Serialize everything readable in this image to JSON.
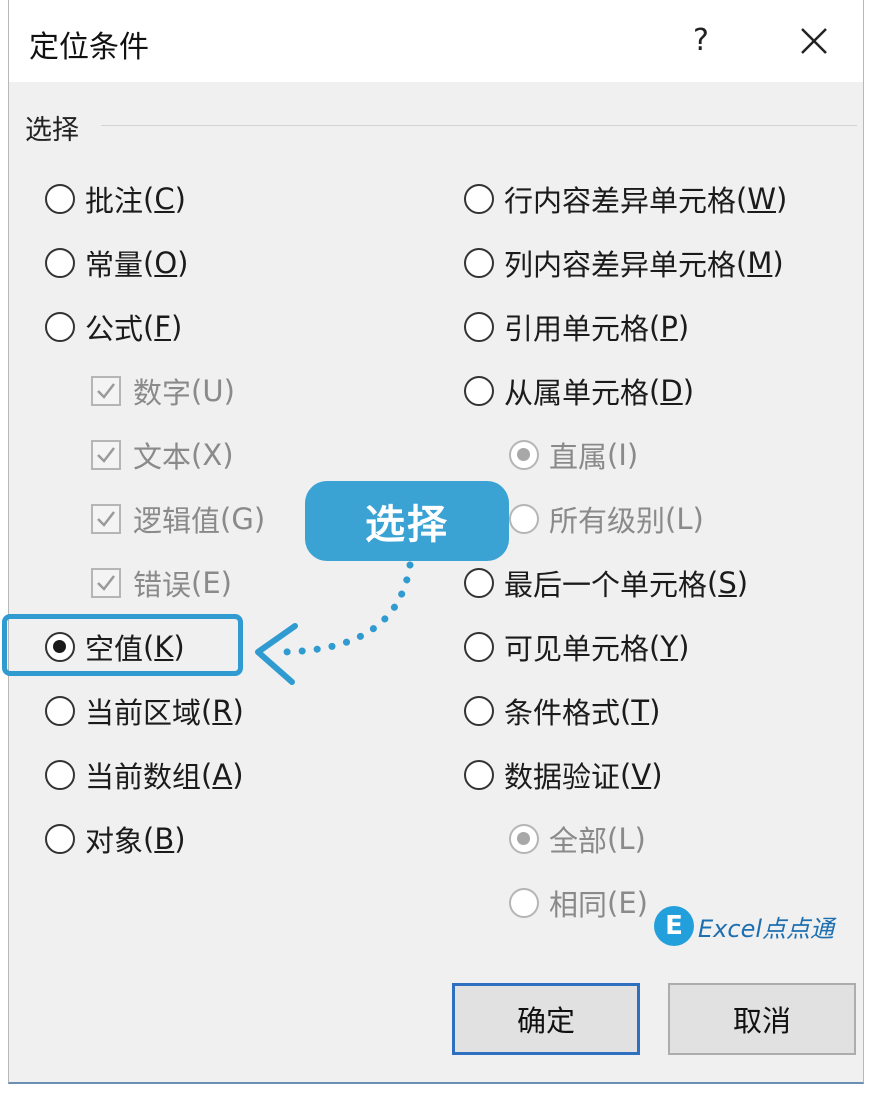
{
  "dialog": {
    "title": "定位条件",
    "help_label": "?",
    "group_title": "选择"
  },
  "left_options": [
    {
      "label": "批注",
      "key": "C",
      "type": "radio",
      "checked": false,
      "disabled": false
    },
    {
      "label": "常量",
      "key": "O",
      "type": "radio",
      "checked": false,
      "disabled": false
    },
    {
      "label": "公式",
      "key": "F",
      "type": "radio",
      "checked": false,
      "disabled": false
    },
    {
      "label": "数字",
      "key": "U",
      "type": "checkbox",
      "checked": true,
      "disabled": true
    },
    {
      "label": "文本",
      "key": "X",
      "type": "checkbox",
      "checked": true,
      "disabled": true
    },
    {
      "label": "逻辑值",
      "key": "G",
      "type": "checkbox",
      "checked": true,
      "disabled": true
    },
    {
      "label": "错误",
      "key": "E",
      "type": "checkbox",
      "checked": true,
      "disabled": true
    },
    {
      "label": "空值",
      "key": "K",
      "type": "radio",
      "checked": true,
      "disabled": false
    },
    {
      "label": "当前区域",
      "key": "R",
      "type": "radio",
      "checked": false,
      "disabled": false
    },
    {
      "label": "当前数组",
      "key": "A",
      "type": "radio",
      "checked": false,
      "disabled": false
    },
    {
      "label": "对象",
      "key": "B",
      "type": "radio",
      "checked": false,
      "disabled": false
    }
  ],
  "right_options": [
    {
      "label": "行内容差异单元格",
      "key": "W",
      "type": "radio",
      "checked": false,
      "disabled": false
    },
    {
      "label": "列内容差异单元格",
      "key": "M",
      "type": "radio",
      "checked": false,
      "disabled": false
    },
    {
      "label": "引用单元格",
      "key": "P",
      "type": "radio",
      "checked": false,
      "disabled": false
    },
    {
      "label": "从属单元格",
      "key": "D",
      "type": "radio",
      "checked": false,
      "disabled": false
    },
    {
      "label": "直属",
      "key": "I",
      "type": "radio",
      "checked": true,
      "disabled": true
    },
    {
      "label": "所有级别",
      "key": "L",
      "type": "radio",
      "checked": false,
      "disabled": true
    },
    {
      "label": "最后一个单元格",
      "key": "S",
      "type": "radio",
      "checked": false,
      "disabled": false
    },
    {
      "label": "可见单元格",
      "key": "Y",
      "type": "radio",
      "checked": false,
      "disabled": false
    },
    {
      "label": "条件格式",
      "key": "T",
      "type": "radio",
      "checked": false,
      "disabled": false
    },
    {
      "label": "数据验证",
      "key": "V",
      "type": "radio",
      "checked": false,
      "disabled": false
    },
    {
      "label": "全部",
      "key": "L",
      "type": "radio",
      "checked": true,
      "disabled": true
    },
    {
      "label": "相同",
      "key": "E",
      "type": "radio",
      "checked": false,
      "disabled": true
    }
  ],
  "buttons": {
    "ok": "确定",
    "cancel": "取消"
  },
  "annotation": {
    "callout_text": "选择",
    "highlight_color": "#2f9bd1"
  },
  "watermark": {
    "logo_letter": "E",
    "text": "Excel点点通"
  },
  "icons": {
    "close": "close-icon",
    "radio": "radio-icon",
    "checkbox": "checkmark-icon"
  }
}
